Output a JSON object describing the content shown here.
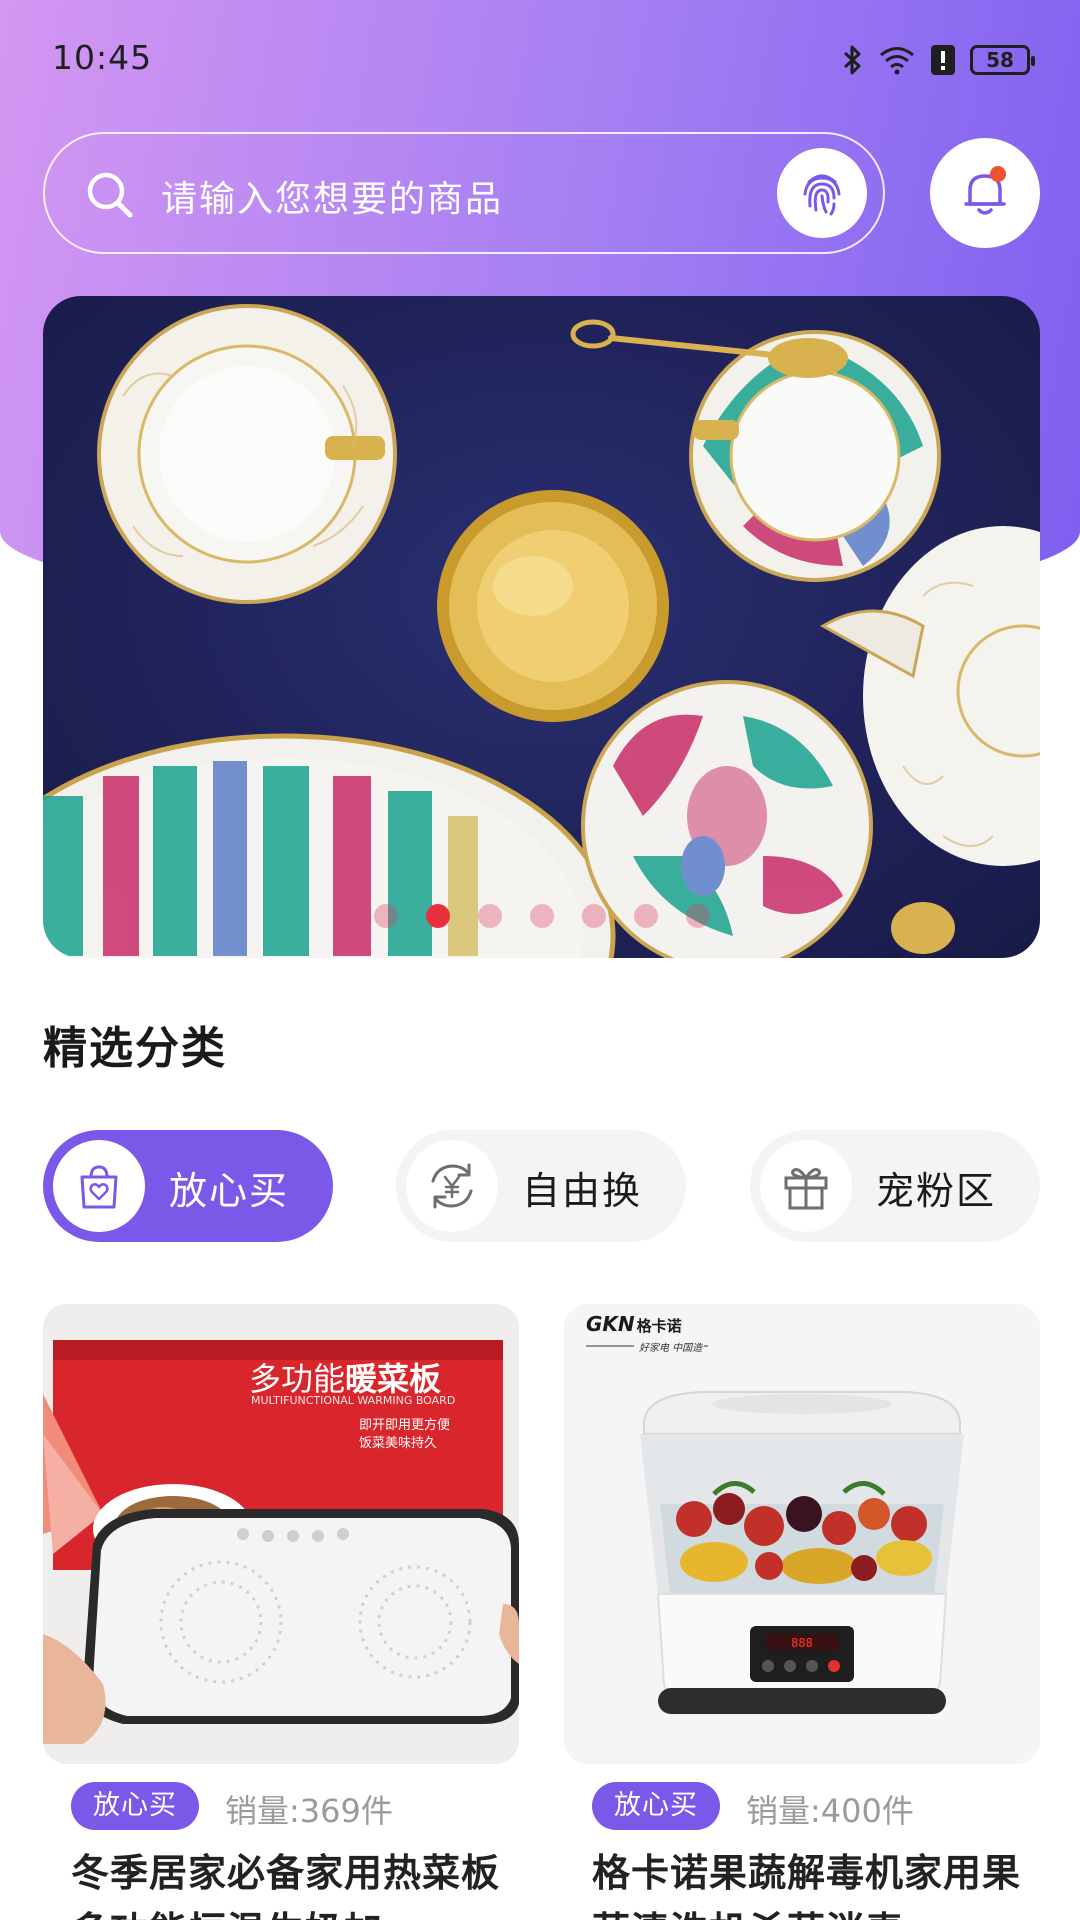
{
  "status_bar": {
    "time": "10:45",
    "battery": "58",
    "icons": [
      "bluetooth-icon",
      "wifi-icon",
      "alert-icon",
      "battery-icon"
    ]
  },
  "search": {
    "placeholder": "请输入您想要的商品"
  },
  "banner": {
    "slide_count": 7,
    "active_index": 1
  },
  "categories": {
    "title": "精选分类",
    "items": [
      {
        "label": "放心买",
        "icon": "heart-bag-icon",
        "active": true
      },
      {
        "label": "自由换",
        "icon": "yuan-exchange-icon",
        "active": false
      },
      {
        "label": "宠粉区",
        "icon": "gift-icon",
        "active": false
      }
    ]
  },
  "products": [
    {
      "tag": "放心买",
      "sales": "销量:369件",
      "title": "冬季居家必备家用热菜板多功能恒温生奶加",
      "image_text": {
        "headline_a": "多功能",
        "headline_b": "暖菜板",
        "subtitle": "MULTIFUNCTIONAL WARMING BOARD",
        "line1": "即开即用更方便",
        "line2": "饭菜美味持久"
      }
    },
    {
      "tag": "放心买",
      "sales": "销量:400件",
      "title": "格卡诺果蔬解毒机家用果蔬清洗机杀菌消毒",
      "image_text": {
        "brand": "GKN",
        "brand_cn": "格卡诺",
        "slogan": "好家电 中国造"
      }
    }
  ],
  "colors": {
    "accent": "#7b59e8",
    "gradient_start": "#d497f2",
    "gradient_end": "#7e5ff0",
    "notification_dot": "#f0542f"
  }
}
